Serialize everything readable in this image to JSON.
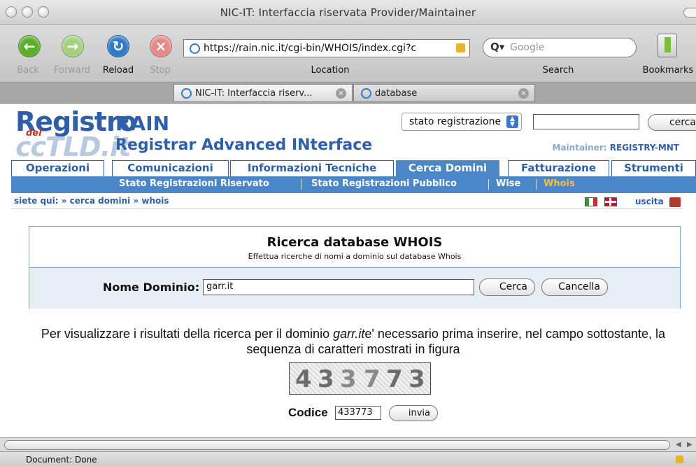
{
  "window": {
    "title": "NIC-IT: Interfaccia riservata Provider/Maintainer"
  },
  "toolbar": {
    "back": "Back",
    "forward": "Forward",
    "reload": "Reload",
    "stop": "Stop",
    "location_label": "Location",
    "search_label": "Search",
    "bookmarks_label": "Bookmarks",
    "url": "https://rain.nic.it/cgi-bin/WHOIS/index.cgi?c",
    "search_placeholder": "Google"
  },
  "tabs": [
    {
      "label": "NIC-IT: Interfaccia riserv..."
    },
    {
      "label": "database"
    }
  ],
  "header": {
    "logo_registro": "Registro",
    "logo_del": "del",
    "logo_cctld": "ccTLD.it",
    "rain": "RAIN",
    "rain_sub": "Registrar Advanced INterface",
    "select_value": "stato registrazione",
    "cerca_btn": "cerca",
    "maintainer_label": "Maintainer:",
    "maintainer_value": "REGISTRY-MNT"
  },
  "main_nav": [
    {
      "label": "Operazioni"
    },
    {
      "label": "Comunicazioni"
    },
    {
      "label": "Informazioni Tecniche"
    },
    {
      "label": "Cerca Domini"
    },
    {
      "label": "Fatturazione"
    },
    {
      "label": "Strumenti"
    }
  ],
  "sub_nav": [
    {
      "label": "Stato Registrazioni Riservato"
    },
    {
      "label": "Stato Registrazioni Pubblico"
    },
    {
      "label": "Wise"
    },
    {
      "label": "Whois"
    }
  ],
  "breadcrumb": "siete qui: » cerca domini » whois",
  "uscita": "uscita",
  "whois": {
    "title": "Ricerca database WHOIS",
    "subtitle": "Effettua ricerche di nomi a dominio sul database Whois",
    "field_label": "Nome Dominio:",
    "field_value": "garr.it",
    "cerca_btn": "Cerca",
    "cancella_btn": "Cancella"
  },
  "instructions": {
    "before": "Per visualizzare i risultati della ricerca per il dominio ",
    "domain": "garr.it",
    "after": "e' necessario prima inserire, nel campo sottostante, la sequenza di caratteri mostrati in figura"
  },
  "captcha": {
    "digits": [
      "4",
      "3",
      "3",
      "7",
      "7",
      "3"
    ]
  },
  "codice": {
    "label": "Codice",
    "value": "433773",
    "submit": "invia"
  },
  "status": {
    "text": "Document: Done"
  }
}
